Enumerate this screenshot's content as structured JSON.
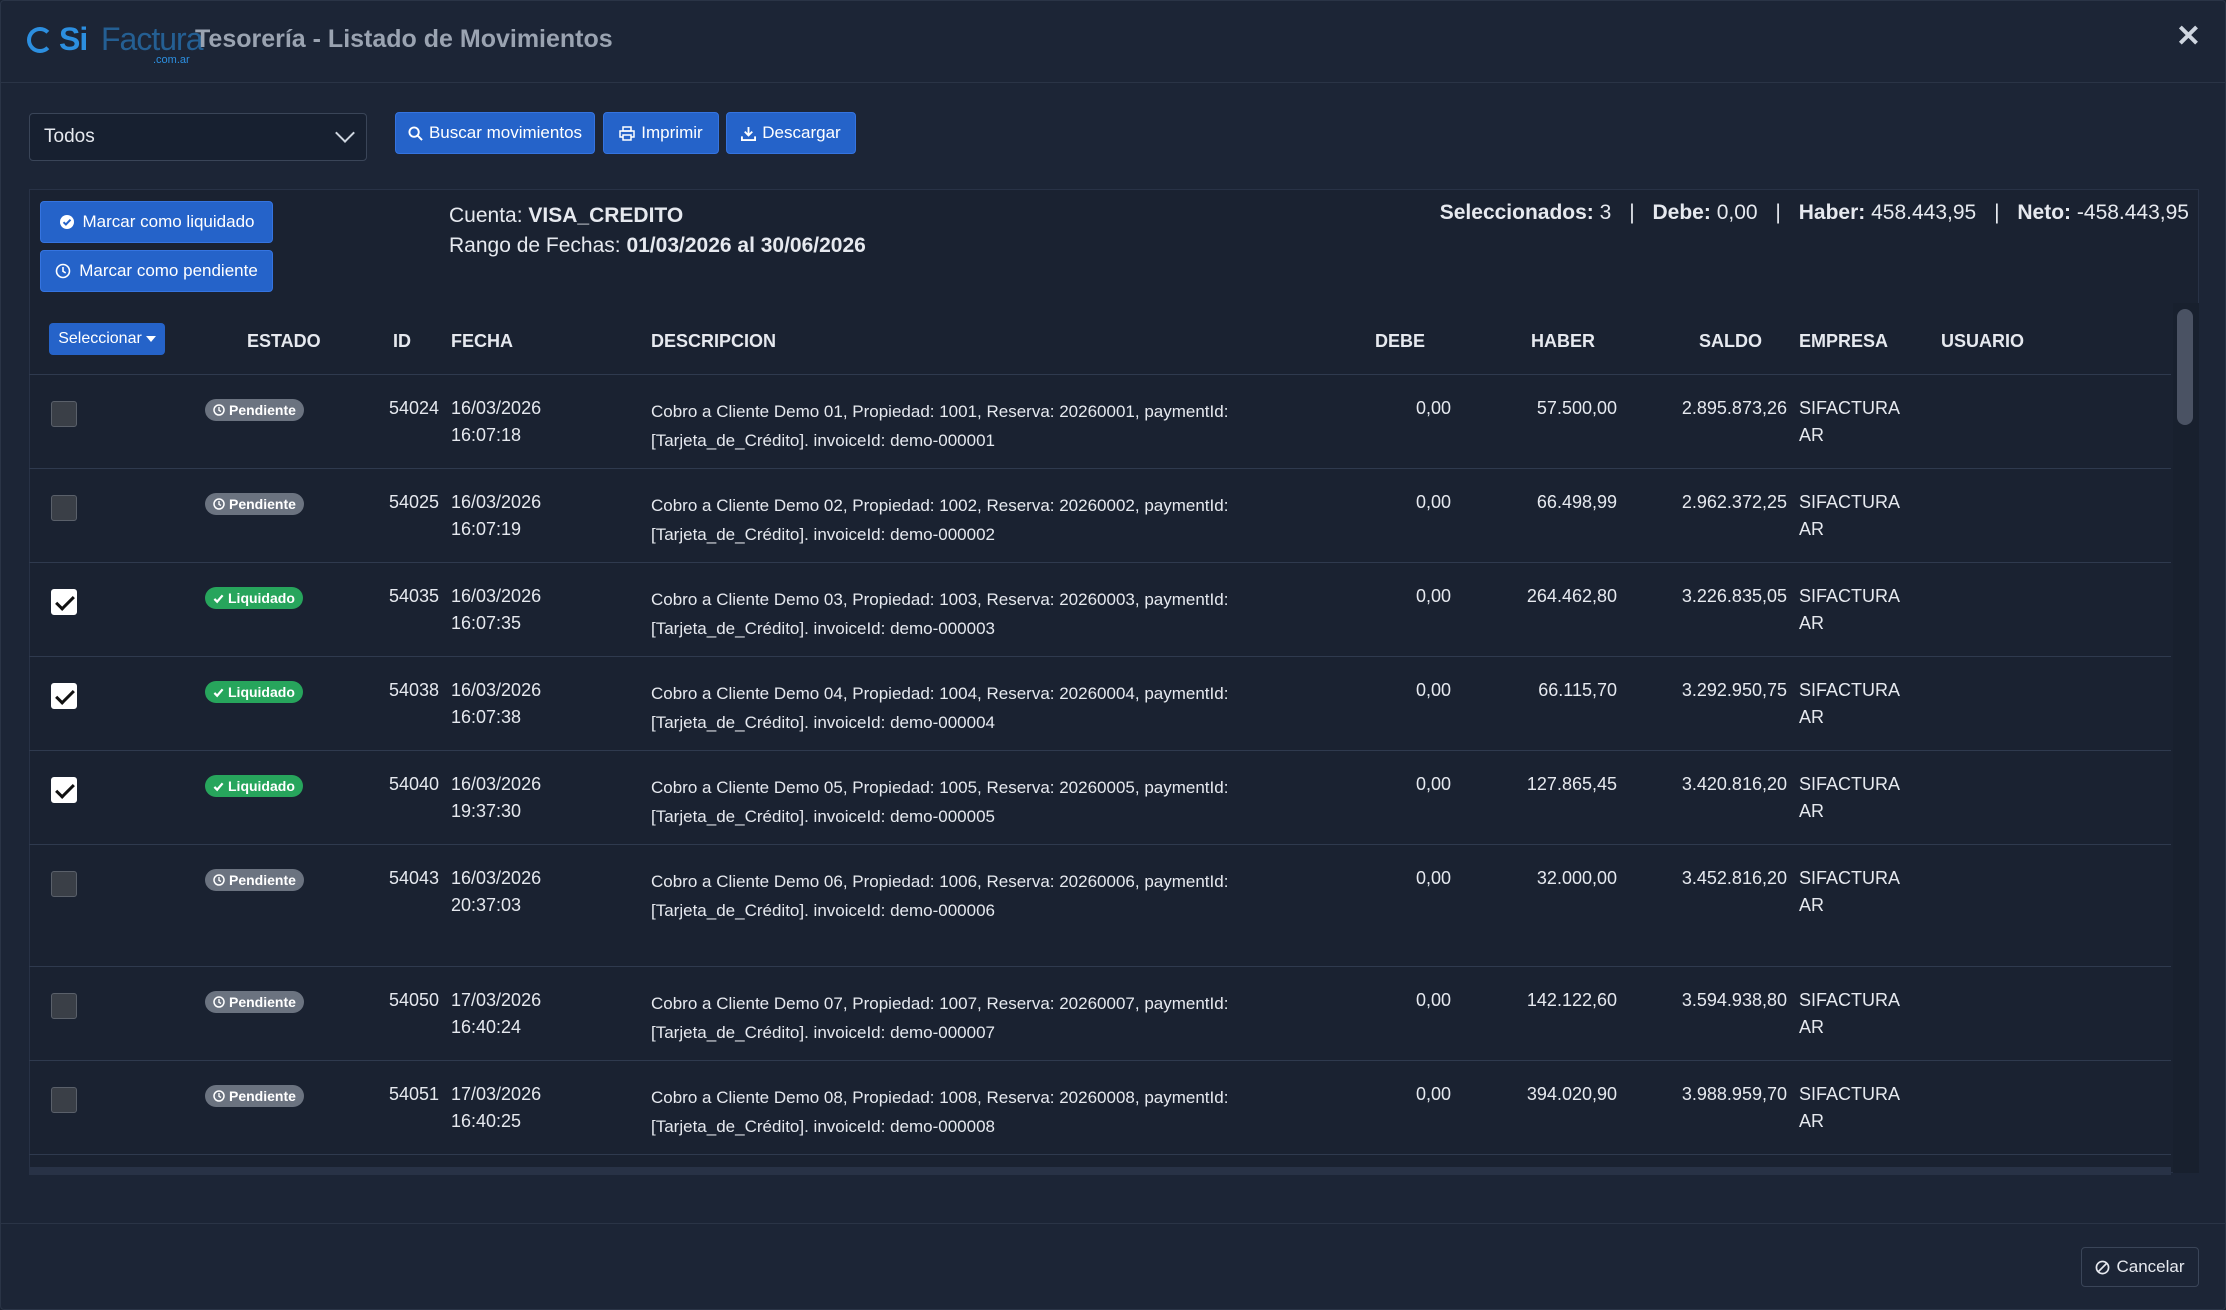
{
  "header": {
    "logo": {
      "si": "Si",
      "factura": "Factura",
      "domain": ".com.ar"
    },
    "title": "Tesorería - Listado de Movimientos",
    "close_icon": "✕"
  },
  "toolbar": {
    "filter_value": "Todos",
    "search_label": "Buscar movimientos",
    "print_label": "Imprimir",
    "download_label": "Descargar"
  },
  "actions": {
    "mark_liquidated": "Marcar como liquidado",
    "mark_pending": "Marcar como pendiente"
  },
  "info": {
    "account_label": "Cuenta:",
    "account_value": "VISA_CREDITO",
    "range_label": "Rango de Fechas:",
    "range_value": "01/03/2026 al 30/06/2026"
  },
  "totals": {
    "selected_label": "Seleccionados:",
    "selected_value": "3",
    "debe_label": "Debe:",
    "debe_value": "0,00",
    "haber_label": "Haber:",
    "haber_value": "458.443,95",
    "neto_label": "Neto:",
    "neto_value": "-458.443,95"
  },
  "table": {
    "select_button": "Seleccionar",
    "columns": [
      "ESTADO",
      "ID",
      "FECHA",
      "DESCRIPCION",
      "DEBE",
      "HABER",
      "SALDO",
      "EMPRESA",
      "USUARIO"
    ],
    "rows": [
      {
        "checked": false,
        "estado": "Pendiente",
        "id": "54024",
        "fecha1": "16/03/2026",
        "fecha2": "16:07:18",
        "desc1": "Cobro a Cliente Demo 01, Propiedad: 1001, Reserva: 20260001, paymentId:",
        "desc2": "[Tarjeta_de_Crédito]. invoiceId: demo-000001",
        "debe": "0,00",
        "haber": "57.500,00",
        "saldo": "2.895.873,26",
        "empresa1": "SIFACTURA",
        "empresa2": "AR"
      },
      {
        "checked": false,
        "estado": "Pendiente",
        "id": "54025",
        "fecha1": "16/03/2026",
        "fecha2": "16:07:19",
        "desc1": "Cobro a Cliente Demo 02, Propiedad: 1002, Reserva: 20260002, paymentId:",
        "desc2": "[Tarjeta_de_Crédito]. invoiceId: demo-000002",
        "debe": "0,00",
        "haber": "66.498,99",
        "saldo": "2.962.372,25",
        "empresa1": "SIFACTURA",
        "empresa2": "AR"
      },
      {
        "checked": true,
        "estado": "Liquidado",
        "id": "54035",
        "fecha1": "16/03/2026",
        "fecha2": "16:07:35",
        "desc1": "Cobro a Cliente Demo 03, Propiedad: 1003, Reserva: 20260003, paymentId:",
        "desc2": "[Tarjeta_de_Crédito]. invoiceId: demo-000003",
        "debe": "0,00",
        "haber": "264.462,80",
        "saldo": "3.226.835,05",
        "empresa1": "SIFACTURA",
        "empresa2": "AR"
      },
      {
        "checked": true,
        "estado": "Liquidado",
        "id": "54038",
        "fecha1": "16/03/2026",
        "fecha2": "16:07:38",
        "desc1": "Cobro a Cliente Demo 04, Propiedad: 1004, Reserva: 20260004, paymentId:",
        "desc2": "[Tarjeta_de_Crédito]. invoiceId: demo-000004",
        "debe": "0,00",
        "haber": "66.115,70",
        "saldo": "3.292.950,75",
        "empresa1": "SIFACTURA",
        "empresa2": "AR"
      },
      {
        "checked": true,
        "estado": "Liquidado",
        "id": "54040",
        "fecha1": "16/03/2026",
        "fecha2": "19:37:30",
        "desc1": "Cobro a Cliente Demo 05, Propiedad: 1005, Reserva: 20260005, paymentId:",
        "desc2": "[Tarjeta_de_Crédito]. invoiceId: demo-000005",
        "debe": "0,00",
        "haber": "127.865,45",
        "saldo": "3.420.816,20",
        "empresa1": "SIFACTURA",
        "empresa2": "AR"
      },
      {
        "checked": false,
        "estado": "Pendiente",
        "id": "54043",
        "fecha1": "16/03/2026",
        "fecha2": "20:37:03",
        "desc1": "Cobro a Cliente Demo 06, Propiedad: 1006, Reserva: 20260006, paymentId:",
        "desc2": "[Tarjeta_de_Crédito]. invoiceId: demo-000006",
        "debe": "0,00",
        "haber": "32.000,00",
        "saldo": "3.452.816,20",
        "empresa1": "SIFACTURA",
        "empresa2": "AR"
      },
      {
        "checked": false,
        "estado": "Pendiente",
        "id": "54050",
        "fecha1": "17/03/2026",
        "fecha2": "16:40:24",
        "desc1": "Cobro a Cliente Demo 07, Propiedad: 1007, Reserva: 20260007, paymentId:",
        "desc2": "[Tarjeta_de_Crédito]. invoiceId: demo-000007",
        "debe": "0,00",
        "haber": "142.122,60",
        "saldo": "3.594.938,80",
        "empresa1": "SIFACTURA",
        "empresa2": "AR"
      },
      {
        "checked": false,
        "estado": "Pendiente",
        "id": "54051",
        "fecha1": "17/03/2026",
        "fecha2": "16:40:25",
        "desc1": "Cobro a Cliente Demo 08, Propiedad: 1008, Reserva: 20260008, paymentId:",
        "desc2": "[Tarjeta_de_Crédito]. invoiceId: demo-000008",
        "debe": "0,00",
        "haber": "394.020,90",
        "saldo": "3.988.959,70",
        "empresa1": "SIFACTURA",
        "empresa2": "AR"
      }
    ]
  },
  "footer": {
    "cancel_label": "Cancelar"
  }
}
